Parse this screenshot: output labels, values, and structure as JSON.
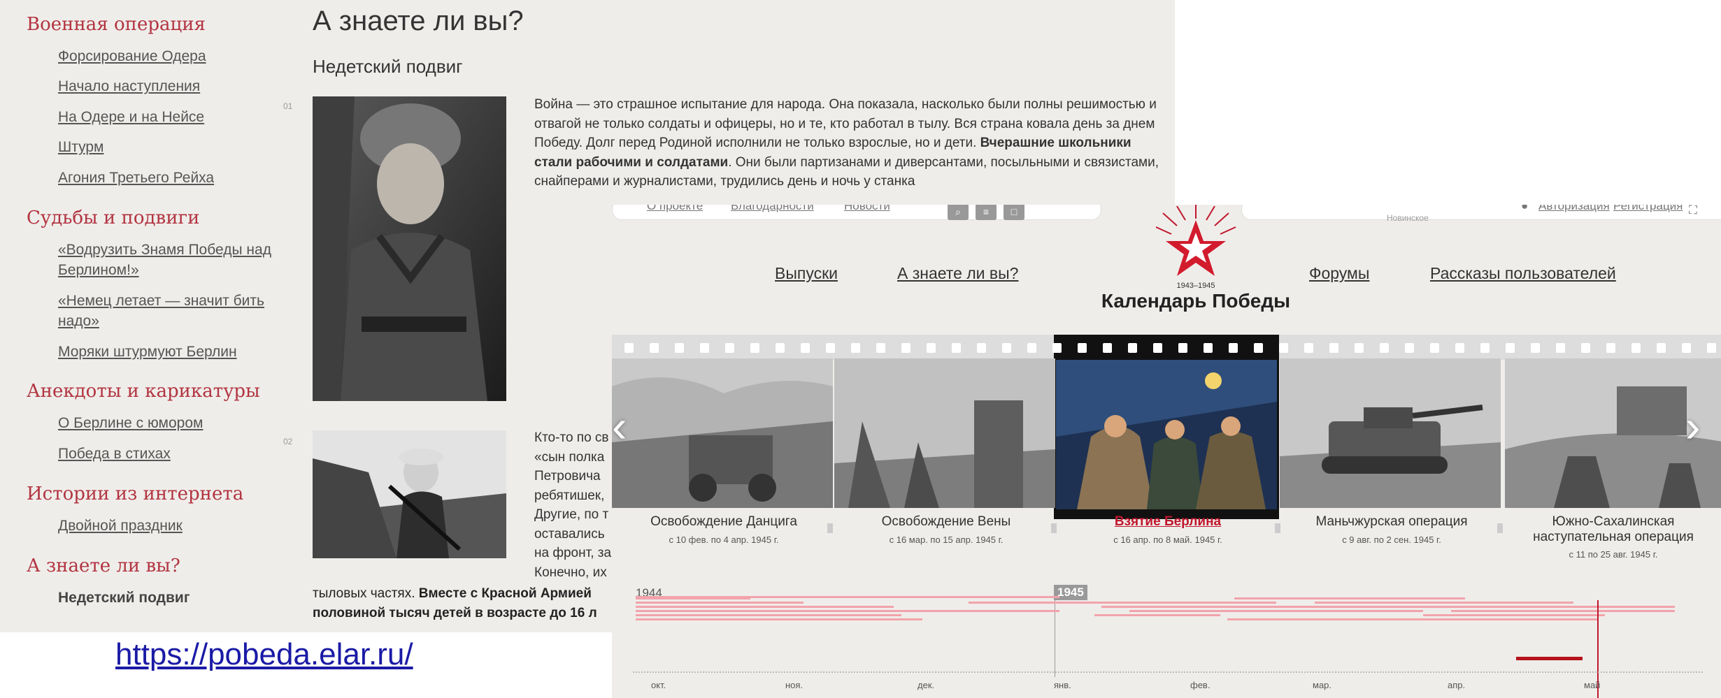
{
  "sidebar": {
    "sections": [
      {
        "title": "Военная операция",
        "items": [
          "Форсирование Одера",
          "Начало наступления",
          "На Одере и на Нейсе",
          "Штурм",
          "Агония Третьего Рейха"
        ]
      },
      {
        "title": "Судьбы и подвиги",
        "items": [
          "«Водрузить Знамя Победы над Берлином!»",
          "«Немец летает — значит бить надо»",
          "Моряки штурмуют Берлин"
        ]
      },
      {
        "title": "Анекдоты и карикатуры",
        "items": [
          "О Берлине с юмором",
          "Победа в стихах"
        ]
      },
      {
        "title": "Истории из интернета",
        "items": [
          "Двойной праздник"
        ]
      },
      {
        "title": "А знаете ли вы?",
        "items": [
          "Недетский подвиг"
        ]
      }
    ]
  },
  "article": {
    "title": "А знаете ли вы?",
    "subtitle": "Недетский подвиг",
    "num1": "01",
    "num2": "02",
    "para1_plain": "Война — это страшное испытание для народа. Она показала, насколько были полны решимостью и отвагой не только солдаты и офицеры, но и те, кто работал в тылу. Вся страна ковала день за днем Победу. Долг перед Родиной исполнили не только взрослые, но и дети. ",
    "para1_bold": "Вчерашние школьники стали рабочими и солдатами",
    "para1_tail": ". Они были партизанами и диверсантами, посыльными и связистами, снайперами и журналистами, трудились день и ночь у станка",
    "para2_lines": [
      "Кто-то по св",
      "«сын полка",
      "Петровича",
      "ребятишек,",
      "Другие, по т",
      "оставались",
      "на фронт, за",
      "Конечно, их"
    ],
    "para3_plain": "тыловых частях. ",
    "para3_bold": "Вместе с Красной Армией",
    "para3_line2": "половиной тысяч детей в возрасте до 16 л"
  },
  "source_link": "https://pobeda.elar.ru/",
  "front": {
    "topstrip": {
      "links": [
        "О проекте",
        "Благодарности",
        "Новости"
      ],
      "right_links": [
        "Авторизация",
        "Регистрация"
      ],
      "placeholder": "Новинское"
    },
    "nav": {
      "left": [
        "Выпуски",
        "А знаете ли вы?"
      ],
      "right": [
        "Форумы",
        "Рассказы пользователей"
      ]
    },
    "logo": {
      "years": "1943–1945",
      "title": "Календарь Победы"
    },
    "operations": [
      {
        "title": "Освобождение Данцига",
        "dates": "с 10 фев. по 4 апр. 1945 г.",
        "active": false
      },
      {
        "title": "Освобождение Вены",
        "dates": "с 16 мар. по 15 апр. 1945 г.",
        "active": false
      },
      {
        "title": "Взятие Берлина",
        "dates": "с 16 апр. по 8 май. 1945 г.",
        "active": true
      },
      {
        "title": "Маньчжурская операция",
        "dates": "с 9 авг. по 2 сен. 1945 г.",
        "active": false
      },
      {
        "title": "Южно-Сахалинская наступательная операция",
        "dates": "с 11 по 25 авг. 1945 г.",
        "active": false
      }
    ],
    "timeline": {
      "year_left": "1944",
      "year_current": "1945",
      "months": [
        "окт.",
        "ноя.",
        "дек.",
        "янв.",
        "фев.",
        "мар.",
        "апр.",
        "май"
      ]
    }
  },
  "colors": {
    "section_red": "#b23440",
    "active_red": "#c0172d",
    "link_blue": "#1a1aa6",
    "bg": "#efedea"
  }
}
